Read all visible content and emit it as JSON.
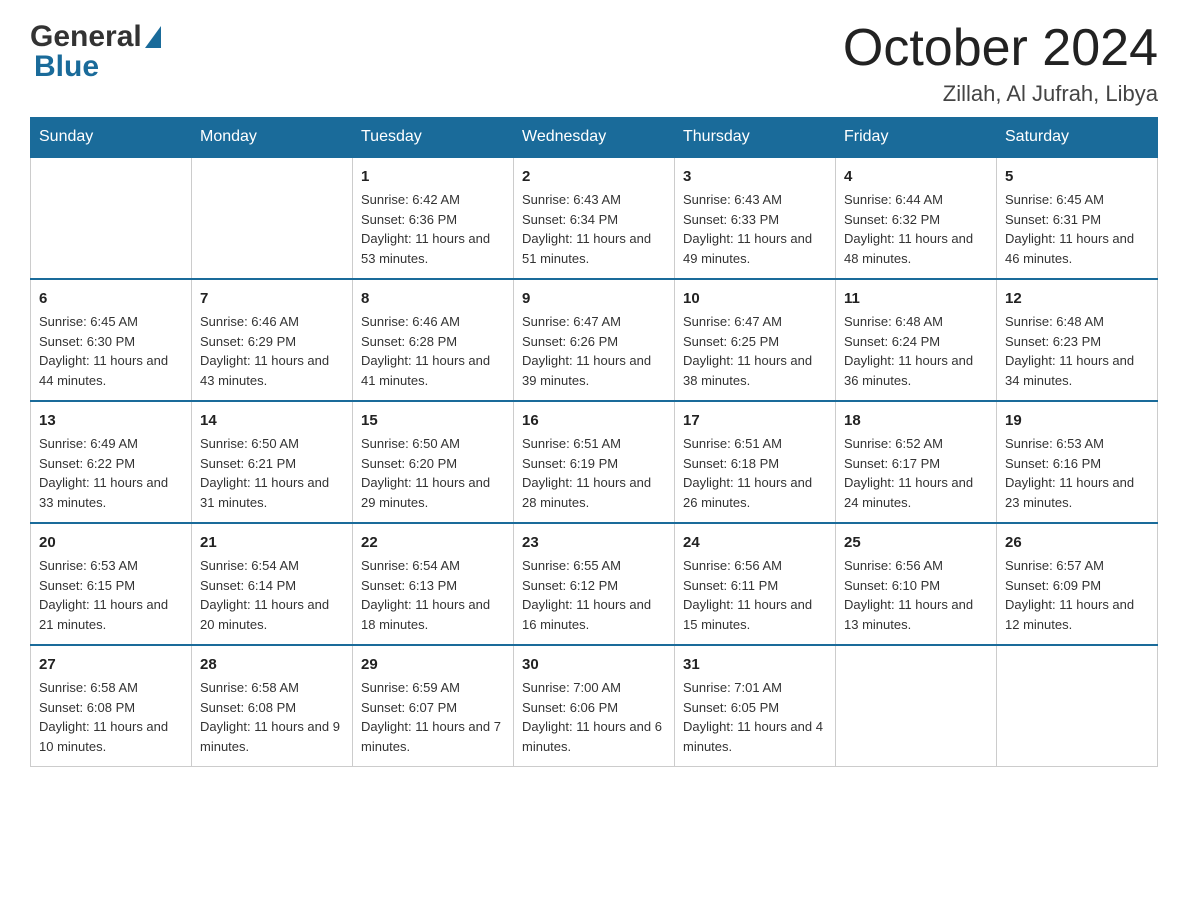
{
  "header": {
    "title": "October 2024",
    "location": "Zillah, Al Jufrah, Libya"
  },
  "logo": {
    "general": "General",
    "blue": "Blue"
  },
  "days_of_week": [
    "Sunday",
    "Monday",
    "Tuesday",
    "Wednesday",
    "Thursday",
    "Friday",
    "Saturday"
  ],
  "weeks": [
    [
      {
        "day": "",
        "sunrise": "",
        "sunset": "",
        "daylight": ""
      },
      {
        "day": "",
        "sunrise": "",
        "sunset": "",
        "daylight": ""
      },
      {
        "day": "1",
        "sunrise": "Sunrise: 6:42 AM",
        "sunset": "Sunset: 6:36 PM",
        "daylight": "Daylight: 11 hours and 53 minutes."
      },
      {
        "day": "2",
        "sunrise": "Sunrise: 6:43 AM",
        "sunset": "Sunset: 6:34 PM",
        "daylight": "Daylight: 11 hours and 51 minutes."
      },
      {
        "day": "3",
        "sunrise": "Sunrise: 6:43 AM",
        "sunset": "Sunset: 6:33 PM",
        "daylight": "Daylight: 11 hours and 49 minutes."
      },
      {
        "day": "4",
        "sunrise": "Sunrise: 6:44 AM",
        "sunset": "Sunset: 6:32 PM",
        "daylight": "Daylight: 11 hours and 48 minutes."
      },
      {
        "day": "5",
        "sunrise": "Sunrise: 6:45 AM",
        "sunset": "Sunset: 6:31 PM",
        "daylight": "Daylight: 11 hours and 46 minutes."
      }
    ],
    [
      {
        "day": "6",
        "sunrise": "Sunrise: 6:45 AM",
        "sunset": "Sunset: 6:30 PM",
        "daylight": "Daylight: 11 hours and 44 minutes."
      },
      {
        "day": "7",
        "sunrise": "Sunrise: 6:46 AM",
        "sunset": "Sunset: 6:29 PM",
        "daylight": "Daylight: 11 hours and 43 minutes."
      },
      {
        "day": "8",
        "sunrise": "Sunrise: 6:46 AM",
        "sunset": "Sunset: 6:28 PM",
        "daylight": "Daylight: 11 hours and 41 minutes."
      },
      {
        "day": "9",
        "sunrise": "Sunrise: 6:47 AM",
        "sunset": "Sunset: 6:26 PM",
        "daylight": "Daylight: 11 hours and 39 minutes."
      },
      {
        "day": "10",
        "sunrise": "Sunrise: 6:47 AM",
        "sunset": "Sunset: 6:25 PM",
        "daylight": "Daylight: 11 hours and 38 minutes."
      },
      {
        "day": "11",
        "sunrise": "Sunrise: 6:48 AM",
        "sunset": "Sunset: 6:24 PM",
        "daylight": "Daylight: 11 hours and 36 minutes."
      },
      {
        "day": "12",
        "sunrise": "Sunrise: 6:48 AM",
        "sunset": "Sunset: 6:23 PM",
        "daylight": "Daylight: 11 hours and 34 minutes."
      }
    ],
    [
      {
        "day": "13",
        "sunrise": "Sunrise: 6:49 AM",
        "sunset": "Sunset: 6:22 PM",
        "daylight": "Daylight: 11 hours and 33 minutes."
      },
      {
        "day": "14",
        "sunrise": "Sunrise: 6:50 AM",
        "sunset": "Sunset: 6:21 PM",
        "daylight": "Daylight: 11 hours and 31 minutes."
      },
      {
        "day": "15",
        "sunrise": "Sunrise: 6:50 AM",
        "sunset": "Sunset: 6:20 PM",
        "daylight": "Daylight: 11 hours and 29 minutes."
      },
      {
        "day": "16",
        "sunrise": "Sunrise: 6:51 AM",
        "sunset": "Sunset: 6:19 PM",
        "daylight": "Daylight: 11 hours and 28 minutes."
      },
      {
        "day": "17",
        "sunrise": "Sunrise: 6:51 AM",
        "sunset": "Sunset: 6:18 PM",
        "daylight": "Daylight: 11 hours and 26 minutes."
      },
      {
        "day": "18",
        "sunrise": "Sunrise: 6:52 AM",
        "sunset": "Sunset: 6:17 PM",
        "daylight": "Daylight: 11 hours and 24 minutes."
      },
      {
        "day": "19",
        "sunrise": "Sunrise: 6:53 AM",
        "sunset": "Sunset: 6:16 PM",
        "daylight": "Daylight: 11 hours and 23 minutes."
      }
    ],
    [
      {
        "day": "20",
        "sunrise": "Sunrise: 6:53 AM",
        "sunset": "Sunset: 6:15 PM",
        "daylight": "Daylight: 11 hours and 21 minutes."
      },
      {
        "day": "21",
        "sunrise": "Sunrise: 6:54 AM",
        "sunset": "Sunset: 6:14 PM",
        "daylight": "Daylight: 11 hours and 20 minutes."
      },
      {
        "day": "22",
        "sunrise": "Sunrise: 6:54 AM",
        "sunset": "Sunset: 6:13 PM",
        "daylight": "Daylight: 11 hours and 18 minutes."
      },
      {
        "day": "23",
        "sunrise": "Sunrise: 6:55 AM",
        "sunset": "Sunset: 6:12 PM",
        "daylight": "Daylight: 11 hours and 16 minutes."
      },
      {
        "day": "24",
        "sunrise": "Sunrise: 6:56 AM",
        "sunset": "Sunset: 6:11 PM",
        "daylight": "Daylight: 11 hours and 15 minutes."
      },
      {
        "day": "25",
        "sunrise": "Sunrise: 6:56 AM",
        "sunset": "Sunset: 6:10 PM",
        "daylight": "Daylight: 11 hours and 13 minutes."
      },
      {
        "day": "26",
        "sunrise": "Sunrise: 6:57 AM",
        "sunset": "Sunset: 6:09 PM",
        "daylight": "Daylight: 11 hours and 12 minutes."
      }
    ],
    [
      {
        "day": "27",
        "sunrise": "Sunrise: 6:58 AM",
        "sunset": "Sunset: 6:08 PM",
        "daylight": "Daylight: 11 hours and 10 minutes."
      },
      {
        "day": "28",
        "sunrise": "Sunrise: 6:58 AM",
        "sunset": "Sunset: 6:08 PM",
        "daylight": "Daylight: 11 hours and 9 minutes."
      },
      {
        "day": "29",
        "sunrise": "Sunrise: 6:59 AM",
        "sunset": "Sunset: 6:07 PM",
        "daylight": "Daylight: 11 hours and 7 minutes."
      },
      {
        "day": "30",
        "sunrise": "Sunrise: 7:00 AM",
        "sunset": "Sunset: 6:06 PM",
        "daylight": "Daylight: 11 hours and 6 minutes."
      },
      {
        "day": "31",
        "sunrise": "Sunrise: 7:01 AM",
        "sunset": "Sunset: 6:05 PM",
        "daylight": "Daylight: 11 hours and 4 minutes."
      },
      {
        "day": "",
        "sunrise": "",
        "sunset": "",
        "daylight": ""
      },
      {
        "day": "",
        "sunrise": "",
        "sunset": "",
        "daylight": ""
      }
    ]
  ]
}
